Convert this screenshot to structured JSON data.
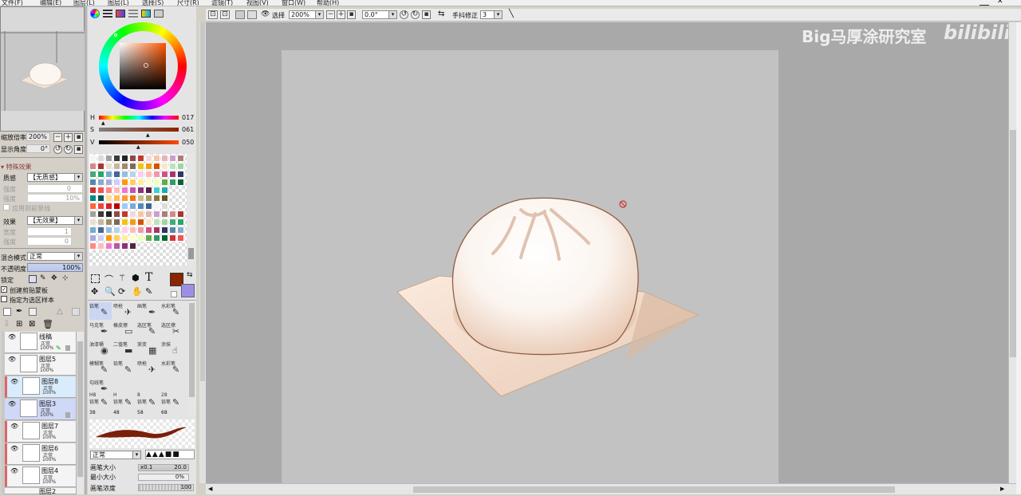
{
  "menu": [
    "文件(F)",
    "编辑(E)",
    "图层(L)",
    "图层(L)",
    "选择(S)",
    "尺寸(R)",
    "滤镜(T)",
    "视图(V)",
    "窗口(W)",
    "帮助(H)"
  ],
  "navigator": {
    "zoom_label": "缩放倍率",
    "zoom_value": "200%",
    "angle_label": "显示角度",
    "angle_value": "0°"
  },
  "effects": {
    "header": "特殊效果",
    "texture_label": "质感",
    "texture_value": "【无质感】",
    "scale_label": "强度",
    "scale_value": "0",
    "strength_label": "强度",
    "strength_value": "10%",
    "apply_label": "应用到前景线",
    "effect_label": "效果",
    "effect_value": "【无效果】",
    "width_label": "宽度",
    "width_value": "1",
    "strength2_label": "强度",
    "strength2_value": "0"
  },
  "layer_props": {
    "blend_label": "混合模式",
    "blend_value": "正常",
    "opacity_label": "不透明度",
    "opacity_value": "100%",
    "lock_label": "锁定",
    "clip_label": "创建剪贴蒙板",
    "select_source_label": "指定为选区样本"
  },
  "layers": [
    {
      "name": "线稿",
      "mode": "正常",
      "opacity": "100%"
    },
    {
      "name": "图层5",
      "mode": "正常",
      "opacity": "100%"
    },
    {
      "name": "图层8",
      "mode": "正常",
      "opacity": "100%"
    },
    {
      "name": "图层3",
      "mode": "正常",
      "opacity": "100%"
    },
    {
      "name": "图层7",
      "mode": "正常",
      "opacity": "100%"
    },
    {
      "name": "图层6",
      "mode": "正常",
      "opacity": "100%"
    },
    {
      "name": "图层4",
      "mode": "正常",
      "opacity": "100%"
    },
    {
      "name": "图层2",
      "mode": "",
      "opacity": ""
    }
  ],
  "hsv": {
    "h_label": "H",
    "h_value": "017",
    "s_label": "S",
    "s_value": "061",
    "v_label": "V",
    "v_value": "050"
  },
  "tools": [
    "铅笔",
    "喷枪",
    "画笔",
    "水彩笔",
    "马克笔",
    "橡皮擦",
    "选区笔",
    "选区擦",
    "油漆桶",
    "二值笔",
    "渐变",
    "涂抹",
    "模糊笔",
    "铅笔",
    "喷枪",
    "水彩笔",
    "勾线笔"
  ],
  "brush_sizes": [
    "H8",
    "H",
    "8",
    "28"
  ],
  "brush_size_names": [
    "铅笔",
    "铅笔",
    "铅笔",
    "铅笔"
  ],
  "brush_size_row2": [
    "38",
    "48",
    "58",
    "68"
  ],
  "brush": {
    "blend_value": "正常",
    "size_label": "画笔大小",
    "size_mult": "x0.1",
    "size_value": "20.0",
    "min_label": "最小大小",
    "min_value": "0%",
    "density_label": "画笔浓度",
    "density_value": "100"
  },
  "toolbar": {
    "select_label": "选择",
    "zoom_value": "200%",
    "angle_value": "0.0°",
    "stabilizer_label": "手抖修正",
    "stabilizer_value": "3"
  },
  "watermark": {
    "text": "Big马厚涂研究室",
    "logo": "bilibili"
  },
  "colors": {
    "accent": "#3b7dd8",
    "fg_color": "#8b2500",
    "bg_color": "#9d8fe6",
    "canvas_bg": "#a9a9a9",
    "paper": "#c2c2c2"
  }
}
